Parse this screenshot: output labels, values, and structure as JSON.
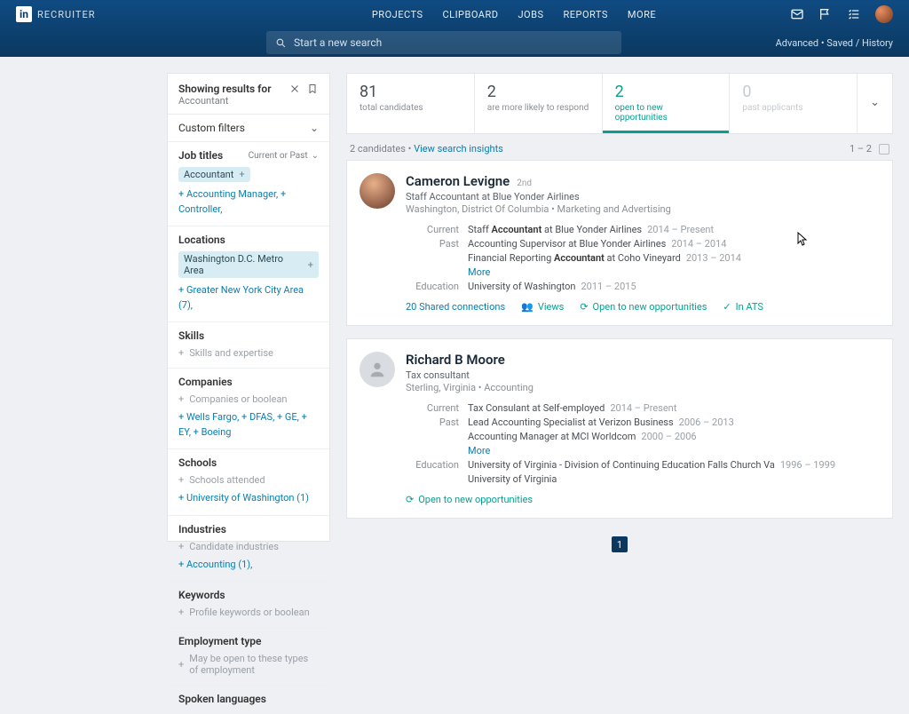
{
  "header": {
    "brand": "RECRUITER",
    "brand_logo": "in",
    "nav": {
      "projects": "PROJECTS",
      "clipboard": "CLIPBOARD",
      "jobs": "JOBS",
      "reports": "REPORTS",
      "more": "MORE"
    },
    "search_placeholder": "Start a new search",
    "adv_links": "Advanced • Saved / History"
  },
  "sidebar": {
    "showing": "Showing results for",
    "query": "Accountant",
    "custom_filters": "Custom filters",
    "sections": {
      "job_titles": {
        "title": "Job titles",
        "scope": "Current or Past",
        "chips": [
          "Accountant"
        ],
        "suggest": "+ Accounting Manager,  + Controller,"
      },
      "locations": {
        "title": "Locations",
        "chips": [
          "Washington D.C. Metro Area"
        ],
        "suggest": "+ Greater New York City Area (7),"
      },
      "skills": {
        "title": "Skills",
        "placeholder": "Skills and expertise"
      },
      "companies": {
        "title": "Companies",
        "placeholder": "Companies or boolean",
        "suggest": "+ Wells Fargo,  + DFAS,  + GE,  + EY,  + Boeing"
      },
      "schools": {
        "title": "Schools",
        "placeholder": "Schools attended",
        "suggest": "+ University of Washington (1)"
      },
      "industries": {
        "title": "Industries",
        "placeholder": "Candidate industries",
        "suggest": "+ Accounting (1),"
      },
      "keywords": {
        "title": "Keywords",
        "placeholder": "Profile keywords or boolean"
      },
      "employment": {
        "title": "Employment type",
        "placeholder": "May be open to these types of employment"
      },
      "spoken": {
        "title": "Spoken languages"
      }
    }
  },
  "stats": {
    "total": {
      "num": "81",
      "lab": "total candidates"
    },
    "likely": {
      "num": "2",
      "lab": "are more likely to respond"
    },
    "open": {
      "num": "2",
      "lab": "open to new opportunities"
    },
    "past": {
      "num": "0",
      "lab": "past applicants"
    }
  },
  "list_head": {
    "count": "2 candidates",
    "insights": "View search insights",
    "range": "1 – 2"
  },
  "candidates": [
    {
      "name": "Cameron Levigne",
      "degree": "2nd",
      "headline": "Staff Accountant at Blue Yonder Airlines",
      "meta": "Washington, District Of Columbia • Marketing and Advertising",
      "current": "Staff <b>Accountant</b> at Blue Yonder Airlines",
      "current_date": "2014 – Present",
      "past1": "Accounting Supervisor at Blue Yonder Airlines",
      "past1_date": "2014 – 2014",
      "past2": "Financial Reporting <b>Accountant</b> at Coho Vineyard",
      "past2_date": "2013 – 2014",
      "more": "More",
      "education": "University of Washington",
      "education_date": "2011 – 2015",
      "badges": {
        "shared": "20 Shared connections",
        "views": "Views",
        "open": "Open to new opportunities",
        "ats": "In ATS"
      }
    },
    {
      "name": "Richard B Moore",
      "headline": "Tax consultant",
      "meta": "Sterling, Virginia • Accounting",
      "current": "Tax Consulant at Self-employed",
      "current_date": "2014 – Present",
      "past1": "Lead Accounting Specialist at Verizon Business",
      "past1_date": "2006 – 2013",
      "past2": "Accounting Manager at MCI Worldcom",
      "past2_date": "2000 – 2006",
      "more": "More",
      "education": "University of Virginia - Division of Continuing Education Falls Church Va",
      "education_date": "1996 – 1999",
      "education2": "University of Virginia",
      "badges": {
        "open": "Open to new opportunities"
      }
    }
  ],
  "labels": {
    "current": "Current",
    "past": "Past",
    "education": "Education"
  },
  "pager": {
    "page": "1"
  }
}
